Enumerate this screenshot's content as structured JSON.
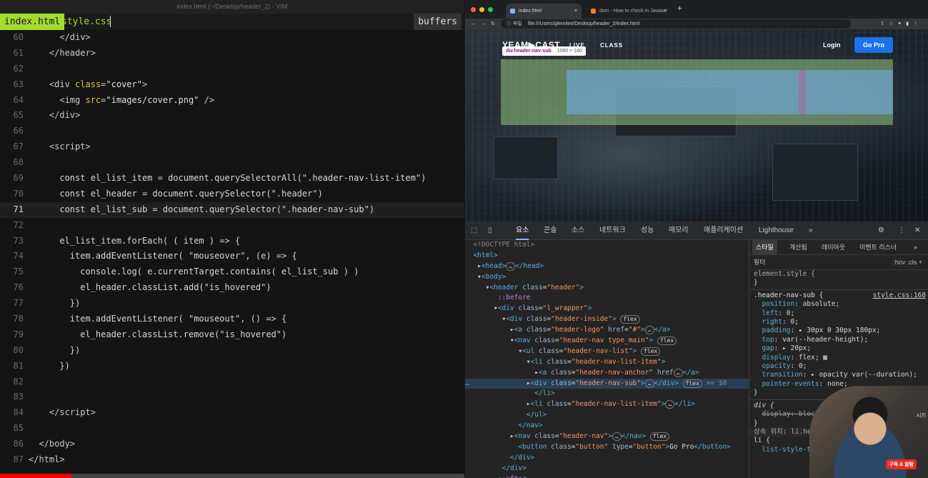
{
  "editor": {
    "title": "index.html (~/Desktop/header_2) - VIM",
    "tabs": [
      "index.html",
      "style.css"
    ],
    "buffers_label": "buffers",
    "current_line": "71"
  },
  "browser": {
    "tabs": [
      {
        "title": "index.html",
        "close": "×"
      },
      {
        "title": "dom - How to check in Javascr",
        "close": "×"
      }
    ],
    "new_tab": "+",
    "url_prefix": "파일",
    "url": "file:///Users/glennlee/Desktop/header_2/index.html",
    "page": {
      "logo": "YEAM▶CAST",
      "nav_live": "LIVE",
      "nav_class": "CLASS",
      "login": "Login",
      "go_pro": "Go Pro",
      "tooltip_selector": "div.header-nav-sub",
      "tooltip_size": "1080 × 180"
    }
  },
  "devtools": {
    "tabs": [
      "요소",
      "콘솔",
      "소스",
      "네트워크",
      "성능",
      "메모리",
      "애플리케이션",
      "Lighthouse",
      "»"
    ],
    "styles_tabs": [
      "스타일",
      "계산됨",
      "레이아웃",
      "이벤트 리스너",
      "»"
    ],
    "filter_placeholder": "필터",
    "filter_right": ":hov  .cls  +",
    "element_style": "element.style {",
    "rule_selector": ".header-nav-sub {",
    "rule_source": "style.css:168",
    "div_rule": "div {",
    "inherited": "상속 위치: li.he",
    "li_rule": "li {",
    "li_prop": "list-style-ty"
  },
  "webcam": {
    "badge": "구독 & 알람",
    "side_text": "시트"
  }
}
